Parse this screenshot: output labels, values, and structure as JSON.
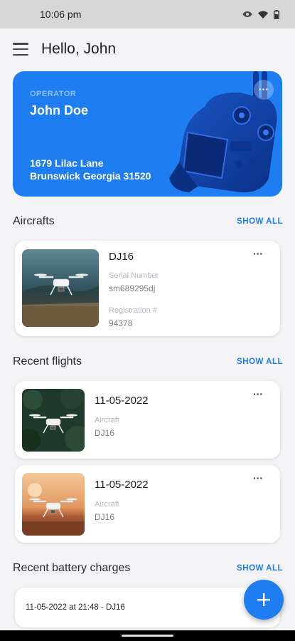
{
  "status": {
    "time": "10:06 pm"
  },
  "appbar": {
    "title": "Hello, John"
  },
  "operator": {
    "label": "OPERATOR",
    "name": "John Doe",
    "address_line1": "1679 Lilac Lane",
    "address_line2": "Brunswick Georgia 31520",
    "more": "···"
  },
  "aircrafts": {
    "title": "Aircrafts",
    "show_all": "SHOW ALL",
    "items": [
      {
        "name": "DJ16",
        "serial_label": "Serial Number",
        "serial": "sm689295dj",
        "reg_label": "Registration #",
        "reg": "94378",
        "more": "···"
      }
    ]
  },
  "flights": {
    "title": "Recent flights",
    "show_all": "SHOW ALL",
    "items": [
      {
        "date": "11-05-2022",
        "aircraft_label": "Aircraft",
        "aircraft": "DJ16",
        "more": "···"
      },
      {
        "date": "11-05-2022",
        "aircraft_label": "Aircraft",
        "aircraft": "DJ16",
        "more": "···"
      }
    ]
  },
  "battery": {
    "title": "Recent battery charges",
    "show_all": "SHOW ALL",
    "items": [
      {
        "text": "11-05-2022 at 21:48 - DJ16"
      }
    ]
  },
  "fab": {
    "icon": "plus-icon"
  },
  "colors": {
    "accent": "#1f7df2",
    "background": "#f3f3f5",
    "card": "#ffffff"
  }
}
